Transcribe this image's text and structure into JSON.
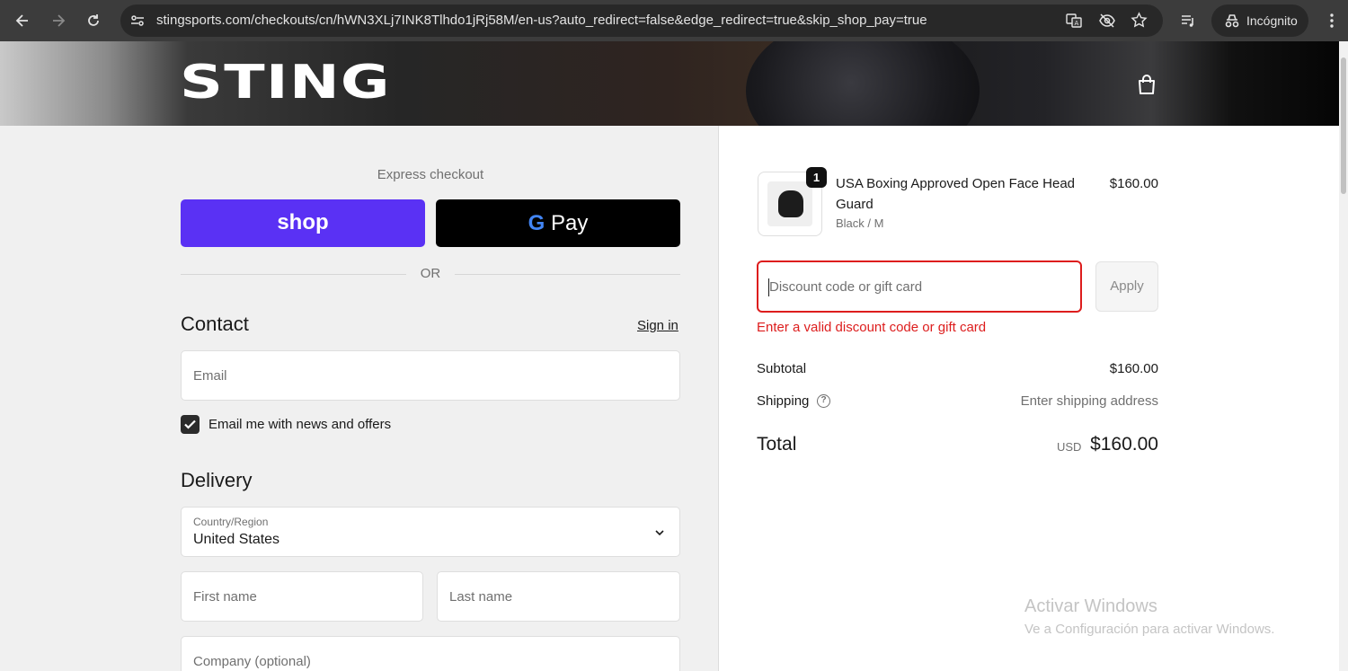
{
  "browser": {
    "url": "stingsports.com/checkouts/cn/hWN3XLj7INK8Tlhdo1jRj58M/en-us?auto_redirect=false&edge_redirect=true&skip_shop_pay=true",
    "profile_label": "Incógnito",
    "icons": [
      "back-icon",
      "forward-icon",
      "reload-icon",
      "site-info-icon",
      "translate-icon",
      "eye-off-icon",
      "star-icon",
      "media-icon",
      "incognito-icon",
      "more-icon"
    ]
  },
  "header": {
    "logo": "STING",
    "cart_icon": "bag-icon"
  },
  "express": {
    "title": "Express checkout",
    "shop_label": "shop",
    "gpay_g": "G",
    "gpay_label": "Pay",
    "or_label": "OR"
  },
  "contact": {
    "heading": "Contact",
    "signin": "Sign in",
    "email_placeholder": "Email",
    "newsletter_label": "Email me with news and offers",
    "newsletter_checked": true
  },
  "delivery": {
    "heading": "Delivery",
    "country_label": "Country/Region",
    "country_value": "United States",
    "first_name_placeholder": "First name",
    "last_name_placeholder": "Last name",
    "company_placeholder": "Company (optional)"
  },
  "summary": {
    "product": {
      "quantity": "1",
      "name": "USA Boxing Approved Open Face Head Guard",
      "variant": "Black / M",
      "price": "$160.00"
    },
    "discount_placeholder": "Discount code or gift card",
    "apply_label": "Apply",
    "error": "Enter a valid discount code or gift card",
    "subtotal_label": "Subtotal",
    "subtotal_value": "$160.00",
    "shipping_label": "Shipping",
    "shipping_value": "Enter shipping address",
    "total_label": "Total",
    "currency": "USD",
    "total_value": "$160.00"
  },
  "watermark": {
    "line1": "Activar Windows",
    "line2": "Ve a Configuración para activar Windows."
  }
}
